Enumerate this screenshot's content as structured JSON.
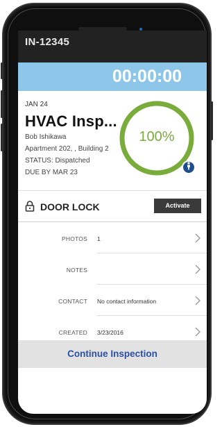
{
  "header": {
    "inspection_id": "IN-12345"
  },
  "timer": {
    "value": "00:00:00"
  },
  "job": {
    "date": "JAN 24",
    "title": "HVAC Insp...",
    "person": "Bob Ishikawa",
    "address": "Apartment 202, , Building 2",
    "status": "STATUS: Dispatched",
    "due": "DUE BY MAR 23"
  },
  "progress": {
    "label": "100%",
    "fraction": 1.0
  },
  "lock": {
    "label": "DOOR LOCK",
    "button_label": "Activate"
  },
  "details": [
    {
      "label": "PHOTOS",
      "value": "1"
    },
    {
      "label": "NOTES",
      "value": ""
    },
    {
      "label": "CONTACT",
      "value": "No contact information"
    },
    {
      "label": "CREATED",
      "value": "3/23/2016"
    }
  ],
  "footer": {
    "continue_label": "Continue Inspection"
  },
  "colors": {
    "timer_bar": "#8ec6ea",
    "progress_ring": "#7aac3b",
    "badge": "#1f4e8f",
    "continue_text": "#2a4fa3",
    "topbar": "#222222"
  },
  "icons": [
    "lock-icon",
    "person-icon",
    "chevron-right-icon"
  ]
}
